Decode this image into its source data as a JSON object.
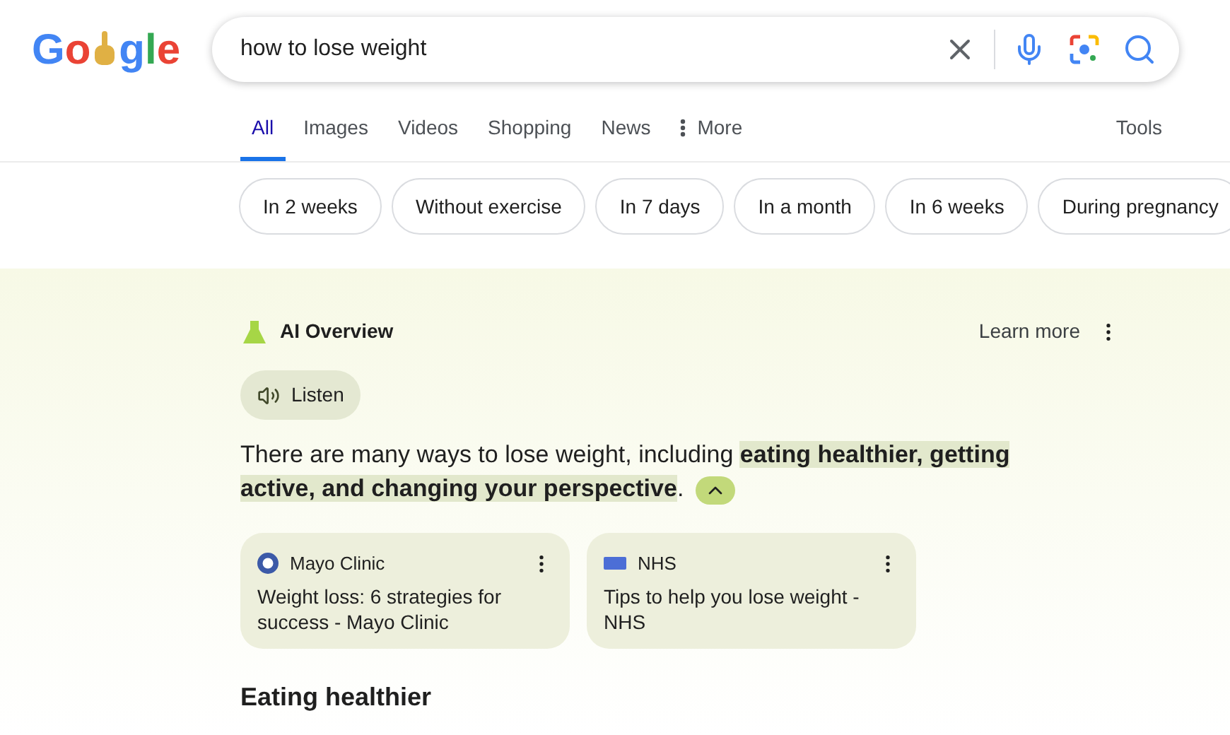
{
  "logo": {
    "letters": [
      {
        "text": "G",
        "color": "#4285f4"
      },
      {
        "text": "o",
        "color": "#ea4335"
      },
      {
        "text": "g",
        "color": "#4285f4"
      },
      {
        "text": "l",
        "color": "#34a853"
      },
      {
        "text": "e",
        "color": "#ea4335"
      }
    ]
  },
  "search": {
    "value": "how to lose weight"
  },
  "tabs": [
    {
      "label": "All",
      "selected": true
    },
    {
      "label": "Images",
      "selected": false
    },
    {
      "label": "Videos",
      "selected": false
    },
    {
      "label": "Shopping",
      "selected": false
    },
    {
      "label": "News",
      "selected": false
    },
    {
      "label": "More",
      "selected": false
    }
  ],
  "tools": "Tools",
  "chips": [
    "In 2 weeks",
    "Without exercise",
    "In 7 days",
    "In a month",
    "In 6 weeks",
    "During pregnancy"
  ],
  "ai_overview": {
    "title": "AI Overview",
    "learn_more": "Learn more",
    "listen": "Listen",
    "summary": {
      "text": "There are many ways to lose weight, including ",
      "highlight": "eating healthier, getting active, and changing your perspective",
      "end": "."
    },
    "sources": [
      {
        "site": "Mayo Clinic",
        "title": "Weight loss: 6 strategies for success - Mayo Clinic"
      },
      {
        "site": "NHS",
        "title": "Tips to help you lose weight - NHS"
      }
    ],
    "heading": "Eating healthier"
  }
}
